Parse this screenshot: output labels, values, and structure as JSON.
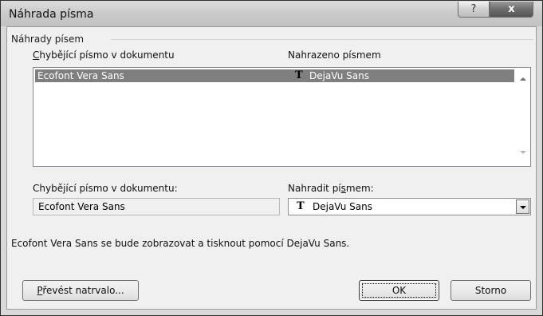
{
  "window": {
    "title": "Náhrada písma",
    "help_label": "?",
    "close_label": "x"
  },
  "group": {
    "label": "Náhrady písem"
  },
  "list": {
    "col_missing_first": "C",
    "col_missing_rest": "hybějící písmo v dokumentu",
    "col_replaced": "Nahrazeno písmem",
    "rows": [
      {
        "missing": "Ecofont Vera Sans",
        "replaced": "DejaVu Sans",
        "selected": true
      }
    ]
  },
  "fields": {
    "missing_label": "Chybějící písmo v dokumentu:",
    "missing_value": "Ecofont Vera Sans",
    "replace_label_before": "Nahradit pí",
    "replace_label_accel": "s",
    "replace_label_after": "mem:",
    "replace_value": "DejaVu Sans"
  },
  "status_text": "Ecofont Vera Sans se bude zobrazovat a tisknout pomocí DejaVu Sans.",
  "buttons": {
    "convert_accel": "P",
    "convert_rest": "řevést natrvalo...",
    "ok": "OK",
    "cancel": "Storno"
  },
  "icons": {
    "truetype": "truetype-font-icon",
    "dropdown": "chevron-down-icon",
    "scroll_up": "scroll-up-arrow-icon",
    "scroll_down": "scroll-down-arrow-icon"
  }
}
